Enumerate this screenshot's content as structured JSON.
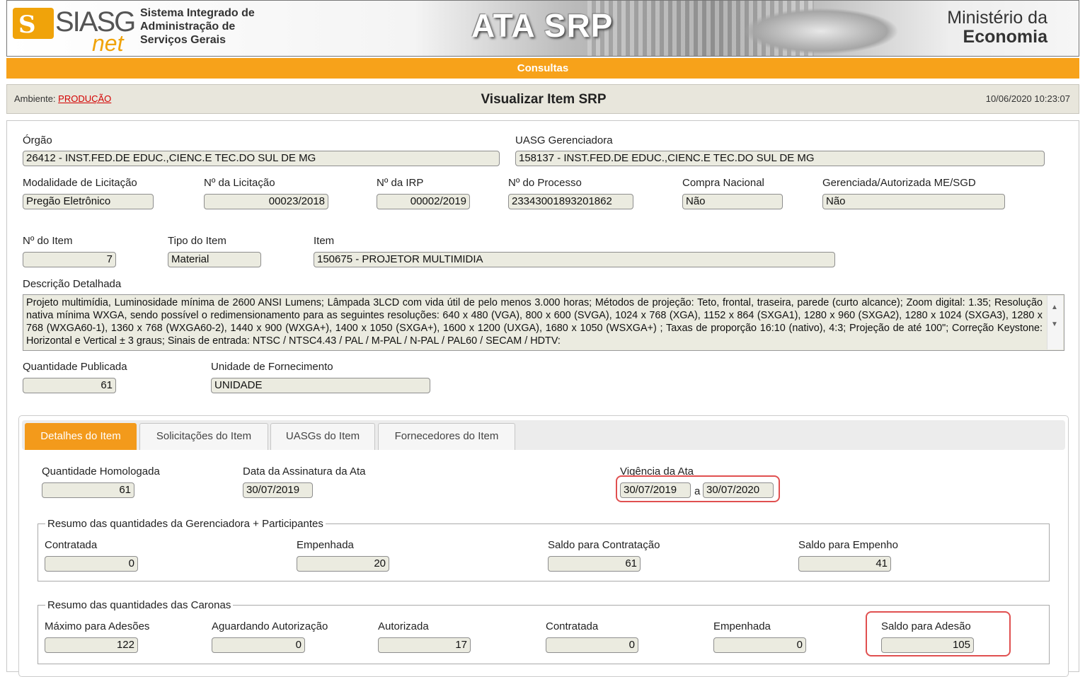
{
  "header": {
    "logo_text": "SIASG",
    "logo_subtext": "net",
    "system_name_lines": [
      "Sistema Integrado de",
      "Administração de",
      "Serviços Gerais"
    ],
    "app_title": "ATA SRP",
    "ministry_line1": "Ministério da",
    "ministry_line2": "Economia"
  },
  "menu": {
    "consultas": "Consultas"
  },
  "titlebar": {
    "ambiente_label": "Ambiente: ",
    "ambiente_value": "PRODUÇÃO",
    "title": "Visualizar Item SRP",
    "timestamp": "10/06/2020 10:23:07"
  },
  "form": {
    "orgao": {
      "label": "Órgão",
      "value": "26412 - INST.FED.DE EDUC.,CIENC.E TEC.DO SUL DE MG"
    },
    "uasg": {
      "label": "UASG Gerenciadora",
      "value": "158137 - INST.FED.DE EDUC.,CIENC.E TEC.DO SUL DE MG"
    },
    "modalidade": {
      "label": "Modalidade de Licitação",
      "value": "Pregão Eletrônico"
    },
    "num_licitacao": {
      "label": "Nº da Licitação",
      "value": "00023/2018"
    },
    "num_irp": {
      "label": "Nº da IRP",
      "value": "00002/2019"
    },
    "num_processo": {
      "label": "Nº do Processo",
      "value": "23343001893201862"
    },
    "compra_nacional": {
      "label": "Compra Nacional",
      "value": "Não"
    },
    "gerenciada": {
      "label": "Gerenciada/Autorizada ME/SGD",
      "value": "Não"
    },
    "num_item": {
      "label": "Nº do Item",
      "value": "7"
    },
    "tipo_item": {
      "label": "Tipo do Item",
      "value": "Material"
    },
    "item": {
      "label": "Item",
      "value": "150675 - PROJETOR MULTIMIDIA"
    },
    "descricao": {
      "label": "Descrição Detalhada",
      "value": "Projeto multimídia, Luminosidade mínima de 2600 ANSI Lumens; Lâmpada 3LCD com vida útil de pelo menos 3.000 horas; Métodos de projeção: Teto, frontal, traseira, parede (curto alcance); Zoom digital: 1.35; Resolução nativa mínima WXGA, sendo possível o redimensionamento para as seguintes resoluções: 640 x 480 (VGA), 800 x 600 (SVGA), 1024 x 768 (XGA), 1152 x 864 (SXGA1), 1280 x 960 (SXGA2), 1280 x 1024 (SXGA3), 1280 x 768 (WXGA60-1), 1360 x 768 (WXGA60-2), 1440 x 900 (WXGA+), 1400 x 1050 (SXGA+), 1600 x 1200 (UXGA), 1680 x 1050 (WSXGA+) ; Taxas de proporção 16:10 (nativo), 4:3; Projeção de até 100\"; Correção Keystone: Horizontal e Vertical ± 3 graus; Sinais de entrada: NTSC / NTSC4.43 / PAL / M-PAL / N-PAL / PAL60 / SECAM / HDTV:"
    },
    "qtd_publicada": {
      "label": "Quantidade Publicada",
      "value": "61"
    },
    "unidade": {
      "label": "Unidade de Fornecimento",
      "value": "UNIDADE"
    }
  },
  "tabs": [
    "Detalhes do Item",
    "Solicitações do Item",
    "UASGs do Item",
    "Fornecedores do Item"
  ],
  "details": {
    "qtd_homologada": {
      "label": "Quantidade Homologada",
      "value": "61"
    },
    "data_assinatura": {
      "label": "Data da Assinatura da Ata",
      "value": "30/07/2019"
    },
    "vigencia": {
      "label": "Vigência da Ata",
      "from": "30/07/2019",
      "sep": "a",
      "to": "30/07/2020"
    },
    "gerenciadora": {
      "legend": "Resumo das quantidades da Gerenciadora + Participantes",
      "contratada": {
        "label": "Contratada",
        "value": "0"
      },
      "empenhada": {
        "label": "Empenhada",
        "value": "20"
      },
      "saldo_contratacao": {
        "label": "Saldo para Contratação",
        "value": "61"
      },
      "saldo_empenho": {
        "label": "Saldo para Empenho",
        "value": "41"
      }
    },
    "caronas": {
      "legend": "Resumo das quantidades das Caronas",
      "maximo": {
        "label": "Máximo para Adesões",
        "value": "122"
      },
      "aguardando": {
        "label": "Aguardando Autorização",
        "value": "0"
      },
      "autorizada": {
        "label": "Autorizada",
        "value": "17"
      },
      "contratada": {
        "label": "Contratada",
        "value": "0"
      },
      "empenhada": {
        "label": "Empenhada",
        "value": "0"
      },
      "saldo_adesao": {
        "label": "Saldo para Adesão",
        "value": "105"
      }
    }
  },
  "colors": {
    "accent": "#f7a21a",
    "highlight": "#e05050",
    "field_bg": "#ebebe0"
  }
}
